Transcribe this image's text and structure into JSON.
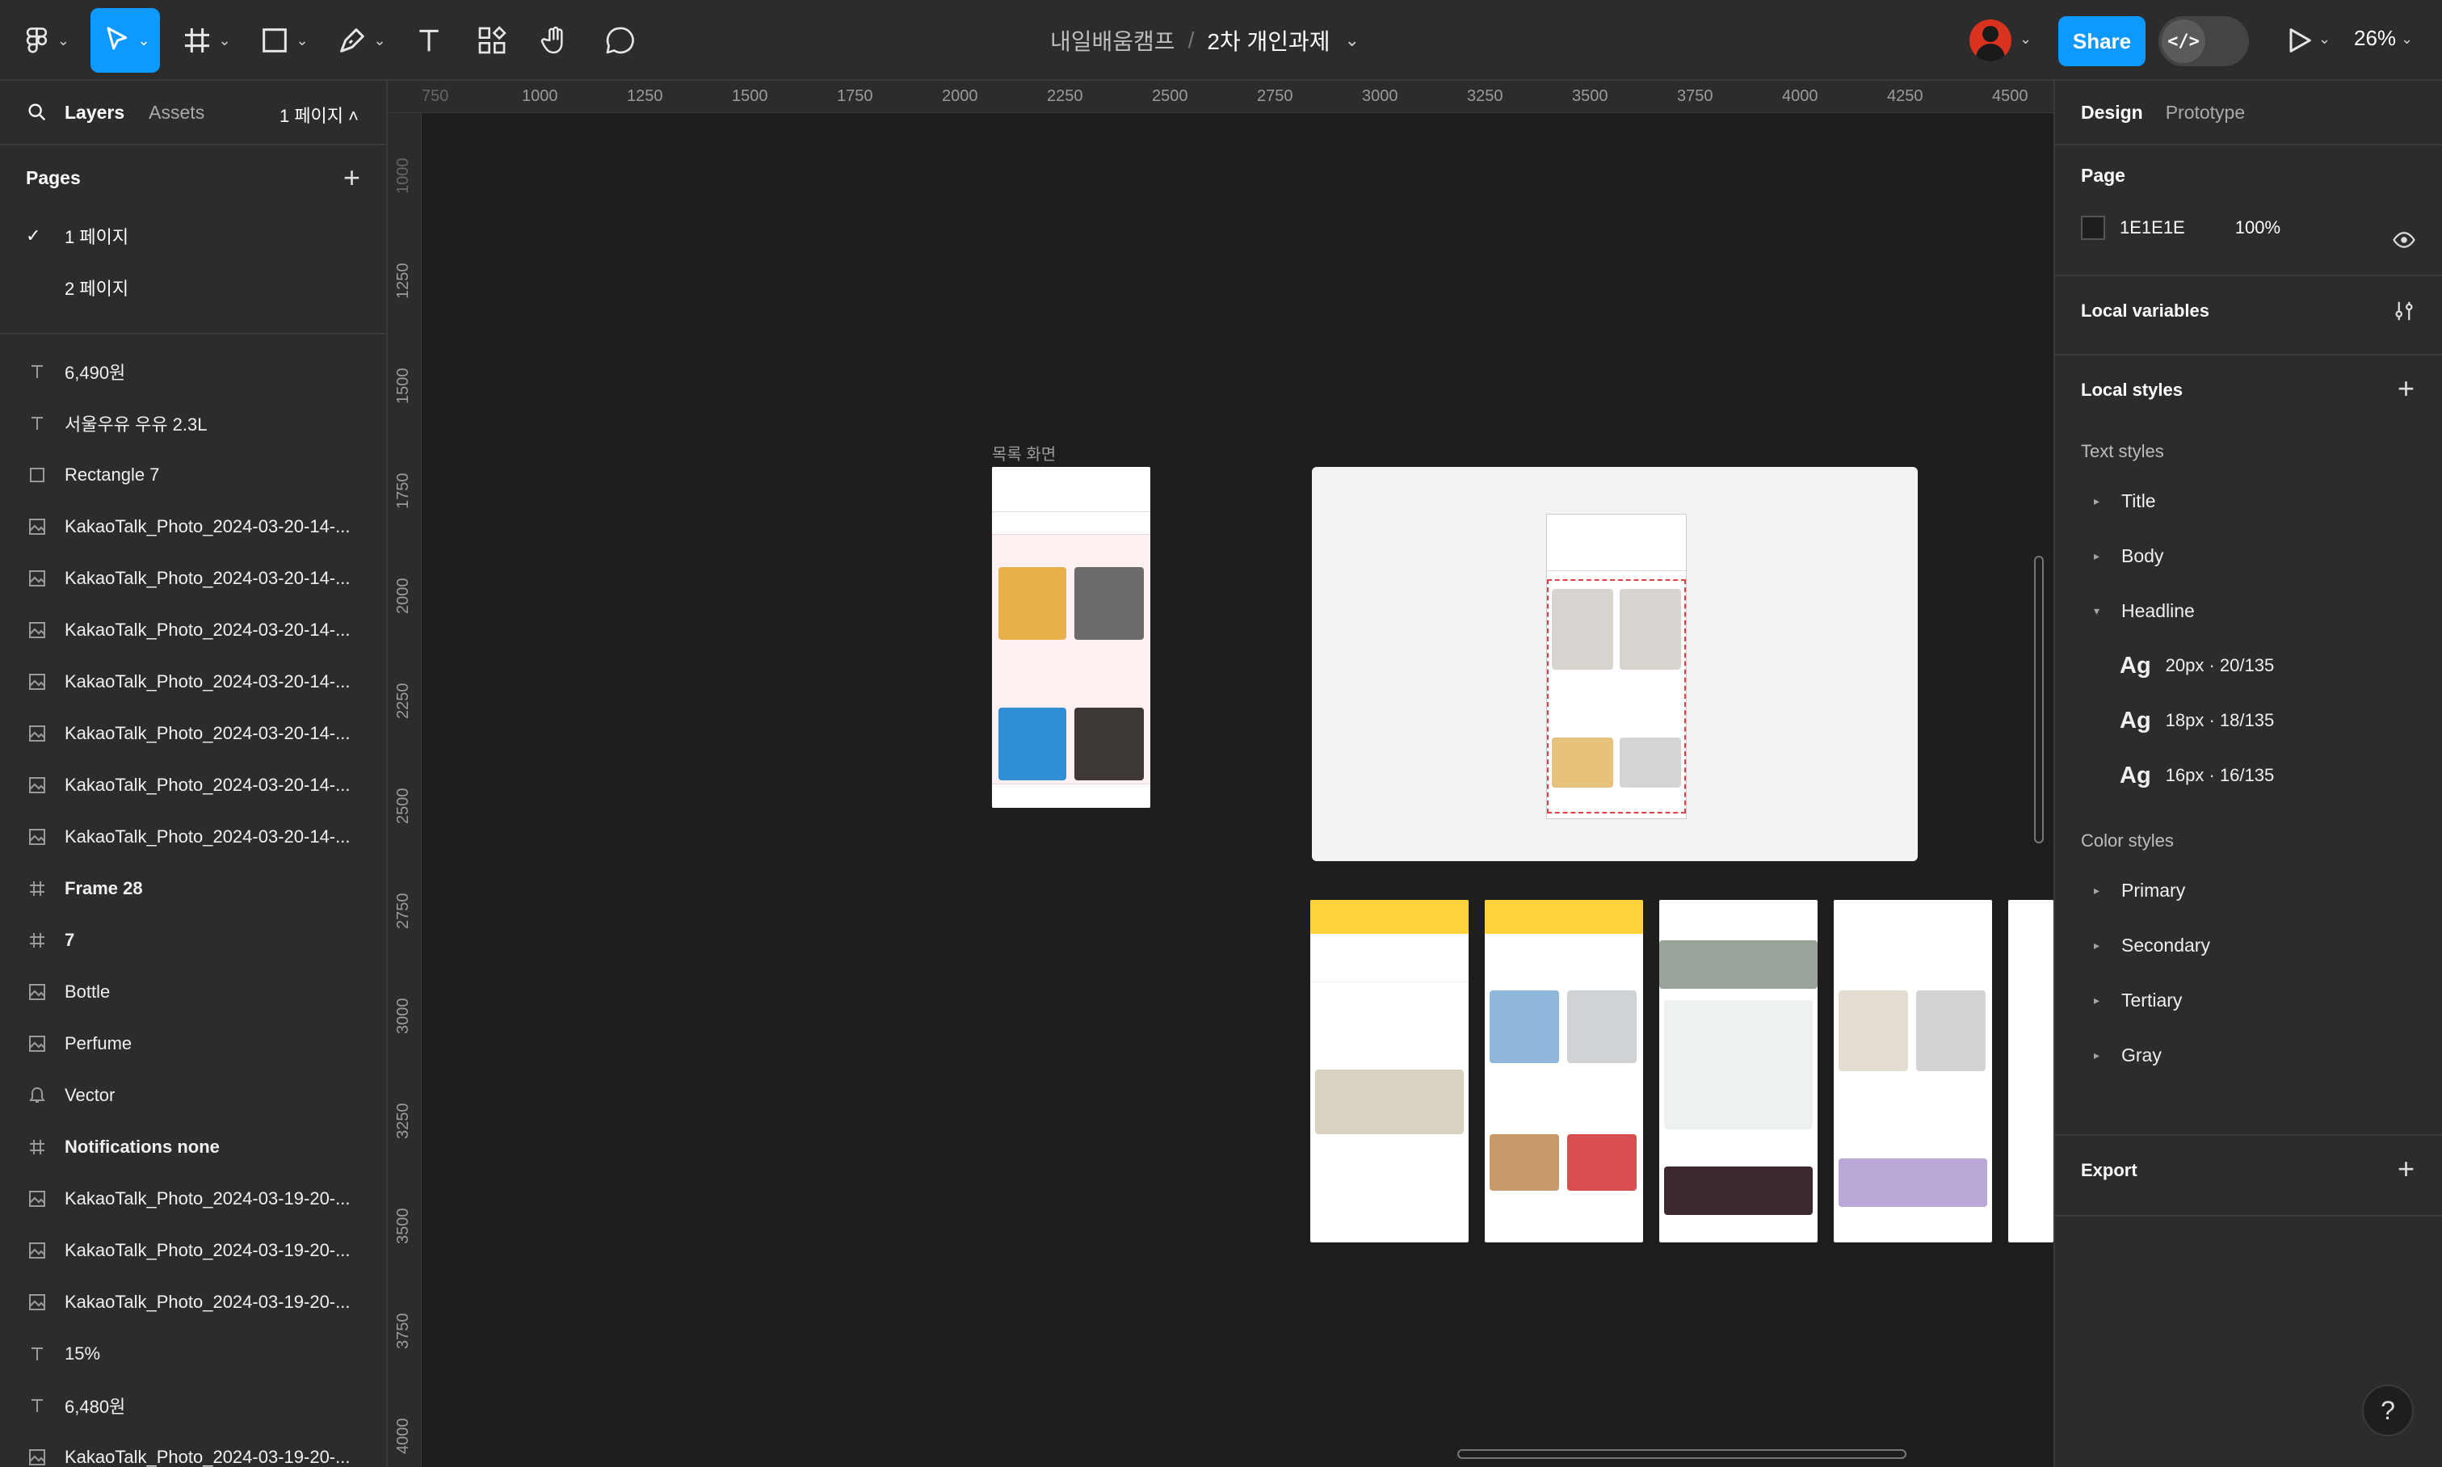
{
  "toolbar": {
    "file_team": "내일배움캠프",
    "file_separator": "/",
    "file_name": "2차 개인과제",
    "share_label": "Share",
    "dev_mode_label": "</>",
    "zoom": "26%"
  },
  "left_panel": {
    "tabs": [
      {
        "label": "Layers"
      },
      {
        "label": "Assets"
      }
    ],
    "page_selector": "1 페이지 ˄",
    "pages_title": "Pages",
    "pages": [
      {
        "label": "1 페이지",
        "selected": true
      },
      {
        "label": "2 페이지",
        "selected": false
      }
    ],
    "layers": [
      {
        "type": "text",
        "label": "6,490원"
      },
      {
        "type": "text",
        "label": "서울우유 우유 2.3L"
      },
      {
        "type": "rect",
        "label": "Rectangle 7"
      },
      {
        "type": "image",
        "label": "KakaoTalk_Photo_2024-03-20-14-..."
      },
      {
        "type": "image",
        "label": "KakaoTalk_Photo_2024-03-20-14-..."
      },
      {
        "type": "image",
        "label": "KakaoTalk_Photo_2024-03-20-14-..."
      },
      {
        "type": "image",
        "label": "KakaoTalk_Photo_2024-03-20-14-..."
      },
      {
        "type": "image",
        "label": "KakaoTalk_Photo_2024-03-20-14-..."
      },
      {
        "type": "image",
        "label": "KakaoTalk_Photo_2024-03-20-14-..."
      },
      {
        "type": "image",
        "label": "KakaoTalk_Photo_2024-03-20-14-..."
      },
      {
        "type": "frame",
        "label": "Frame 28"
      },
      {
        "type": "frame",
        "label": "7"
      },
      {
        "type": "image",
        "label": "Bottle"
      },
      {
        "type": "image",
        "label": "Perfume"
      },
      {
        "type": "vector",
        "label": "Vector"
      },
      {
        "type": "frame",
        "label": "Notifications none"
      },
      {
        "type": "image",
        "label": "KakaoTalk_Photo_2024-03-19-20-..."
      },
      {
        "type": "image",
        "label": "KakaoTalk_Photo_2024-03-19-20-..."
      },
      {
        "type": "image",
        "label": "KakaoTalk_Photo_2024-03-19-20-..."
      },
      {
        "type": "text",
        "label": "15%"
      },
      {
        "type": "text",
        "label": "6,480원"
      },
      {
        "type": "image",
        "label": "KakaoTalk_Photo_2024-03-19-20-..."
      }
    ]
  },
  "canvas": {
    "ruler_top": [
      "750",
      "1000",
      "1250",
      "1500",
      "1750",
      "2000",
      "2250",
      "2500",
      "2750",
      "3000",
      "3250",
      "3500",
      "3750",
      "4000",
      "4250",
      "4500"
    ],
    "ruler_left": [
      "1000",
      "1250",
      "1500",
      "1750",
      "2000",
      "2250",
      "2500",
      "2750",
      "3000",
      "3250",
      "3500",
      "3750",
      "4000"
    ],
    "frame_label": "목록 화면",
    "background": "#1E1E1E"
  },
  "right_panel": {
    "tabs": [
      {
        "label": "Design"
      },
      {
        "label": "Prototype"
      }
    ],
    "page_section_title": "Page",
    "page_color": "1E1E1E",
    "page_opacity": "100%",
    "local_variables": "Local variables",
    "local_styles": "Local styles",
    "text_styles_title": "Text styles",
    "text_styles": [
      {
        "label": "Title",
        "expanded": false
      },
      {
        "label": "Body",
        "expanded": false
      },
      {
        "label": "Headline",
        "expanded": true
      }
    ],
    "headline_specs": [
      {
        "ag": "Ag",
        "spec": "20px · 20/135"
      },
      {
        "ag": "Ag",
        "spec": "18px · 18/135"
      },
      {
        "ag": "Ag",
        "spec": "16px · 16/135"
      }
    ],
    "color_styles_title": "Color styles",
    "color_styles": [
      {
        "label": "Primary"
      },
      {
        "label": "Secondary"
      },
      {
        "label": "Tertiary"
      },
      {
        "label": "Gray"
      }
    ],
    "export_title": "Export",
    "help": "?"
  },
  "colors": {
    "accent": "#0D99FF",
    "panel": "#2C2C2C",
    "canvas": "#1E1E1E"
  }
}
